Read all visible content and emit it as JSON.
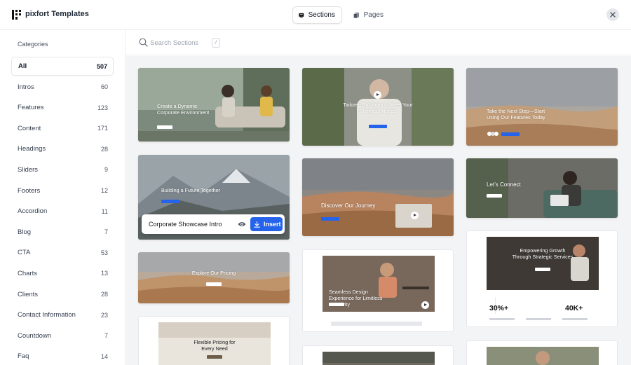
{
  "app": {
    "title": "pixfort Templates"
  },
  "tabs": [
    {
      "label": "Sections",
      "icon": "sections-icon",
      "active": true
    },
    {
      "label": "Pages",
      "icon": "pages-icon",
      "active": false
    }
  ],
  "sidebar": {
    "heading": "Categories",
    "items": [
      {
        "label": "All",
        "count": "507",
        "active": true
      },
      {
        "label": "Intros",
        "count": "60"
      },
      {
        "label": "Features",
        "count": "123"
      },
      {
        "label": "Content",
        "count": "171"
      },
      {
        "label": "Headings",
        "count": "28"
      },
      {
        "label": "Sliders",
        "count": "9"
      },
      {
        "label": "Footers",
        "count": "12"
      },
      {
        "label": "Accordion",
        "count": "11"
      },
      {
        "label": "Blog",
        "count": "7"
      },
      {
        "label": "CTA",
        "count": "53"
      },
      {
        "label": "Charts",
        "count": "13"
      },
      {
        "label": "Clients",
        "count": "28"
      },
      {
        "label": "Contact Information",
        "count": "23"
      },
      {
        "label": "Countdown",
        "count": "7"
      },
      {
        "label": "Faq",
        "count": "14"
      }
    ]
  },
  "search": {
    "placeholder": "Search Sections",
    "shortcut": "/"
  },
  "cards": {
    "c1": {
      "title": "Create a Dynamic Corporate Environment"
    },
    "c2": {
      "title": "Building a Future Together"
    },
    "c3": {
      "title": "Explore Our Pricing"
    },
    "c4": {
      "title": "Flexible Pricing for Every Need"
    },
    "c5": {
      "title": "Tailored Solutions to Meet Your Business Needs"
    },
    "c6": {
      "title": "Discover Our Journey"
    },
    "c7": {
      "title": "Seamless Design Experience for Limitless Creativity"
    },
    "c8": {
      "title": "Take the Next Step—Start Using Our Features Today"
    },
    "c9": {
      "title": "Let’s Connect"
    },
    "c10": {
      "title": "Empowering Growth Through Strategic Services",
      "stats": [
        "30%+",
        "40K+"
      ]
    }
  },
  "hover_card": {
    "title": "Corporate Showcase Intro",
    "insert_label": "Insert"
  },
  "colors": {
    "accent": "#2563eb",
    "grid_bg": "#f3f4f6"
  }
}
